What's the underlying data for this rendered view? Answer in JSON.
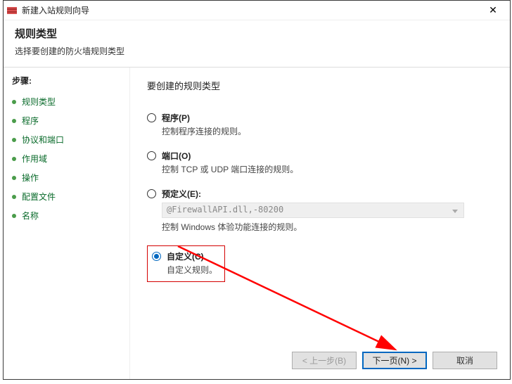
{
  "window": {
    "title": "新建入站规则向导"
  },
  "header": {
    "title": "规则类型",
    "subtitle": "选择要创建的防火墙规则类型"
  },
  "sidebar": {
    "steps_label": "步骤:",
    "items": [
      {
        "label": "规则类型"
      },
      {
        "label": "程序"
      },
      {
        "label": "协议和端口"
      },
      {
        "label": "作用域"
      },
      {
        "label": "操作"
      },
      {
        "label": "配置文件"
      },
      {
        "label": "名称"
      }
    ]
  },
  "main": {
    "heading": "要创建的规则类型",
    "options": {
      "program": {
        "label": "程序(P)",
        "desc": "控制程序连接的规则。"
      },
      "port": {
        "label": "端口(O)",
        "desc": "控制 TCP 或 UDP 端口连接的规则。"
      },
      "predefined": {
        "label": "预定义(E):",
        "dropdown_value": "@FirewallAPI.dll,-80200",
        "desc": "控制 Windows 体验功能连接的规则。"
      },
      "custom": {
        "label": "自定义(C)",
        "desc": "自定义规则。"
      }
    }
  },
  "footer": {
    "back": "< 上一步(B)",
    "next": "下一页(N) >",
    "cancel": "取消"
  }
}
